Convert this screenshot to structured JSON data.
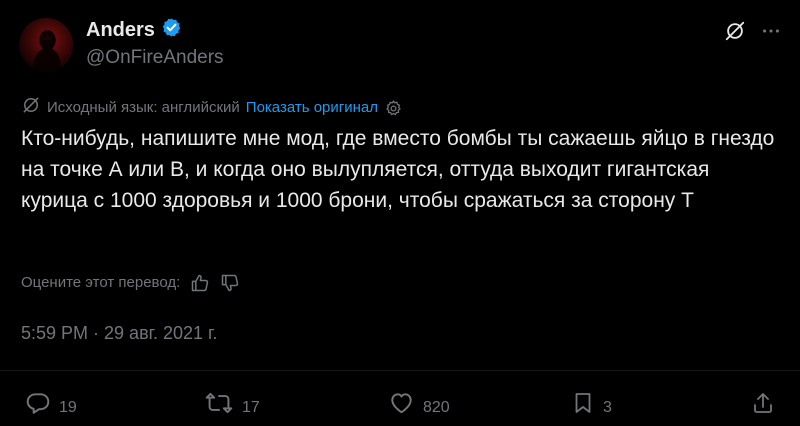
{
  "author": {
    "display_name": "Anders",
    "handle": "@OnFireAnders",
    "verified": true
  },
  "translation": {
    "source_language_label": "Исходный язык: английский",
    "show_original_label": "Показать оригинал"
  },
  "tweet": {
    "text": "Кто-нибудь, напишите мне мод, где вместо бомбы ты сажаешь яйцо в гнездо на точке А или В, и когда оно вылупляется, оттуда выходит гигантская курица с 1000 здоровья и 1000 брони, чтобы сражаться за сторону Т"
  },
  "rating": {
    "label": "Оцените этот перевод:"
  },
  "timestamp": "5:59 PM · 29 авг. 2021 г.",
  "actions": {
    "replies": "19",
    "retweets": "17",
    "likes": "820",
    "bookmarks": "3"
  },
  "icons": {
    "verified": "verified-badge-icon",
    "grok": "grok-icon",
    "more": "more-icon",
    "translate": "translate-icon",
    "settings": "gear-icon",
    "thumbs_up": "thumbs-up-icon",
    "thumbs_down": "thumbs-down-icon",
    "reply": "reply-icon",
    "retweet": "retweet-icon",
    "like": "heart-icon",
    "bookmark": "bookmark-icon",
    "share": "share-icon"
  },
  "colors": {
    "background": "#000000",
    "text_primary": "#e7e9ea",
    "text_secondary": "#71767b",
    "accent": "#1d9bf0"
  }
}
